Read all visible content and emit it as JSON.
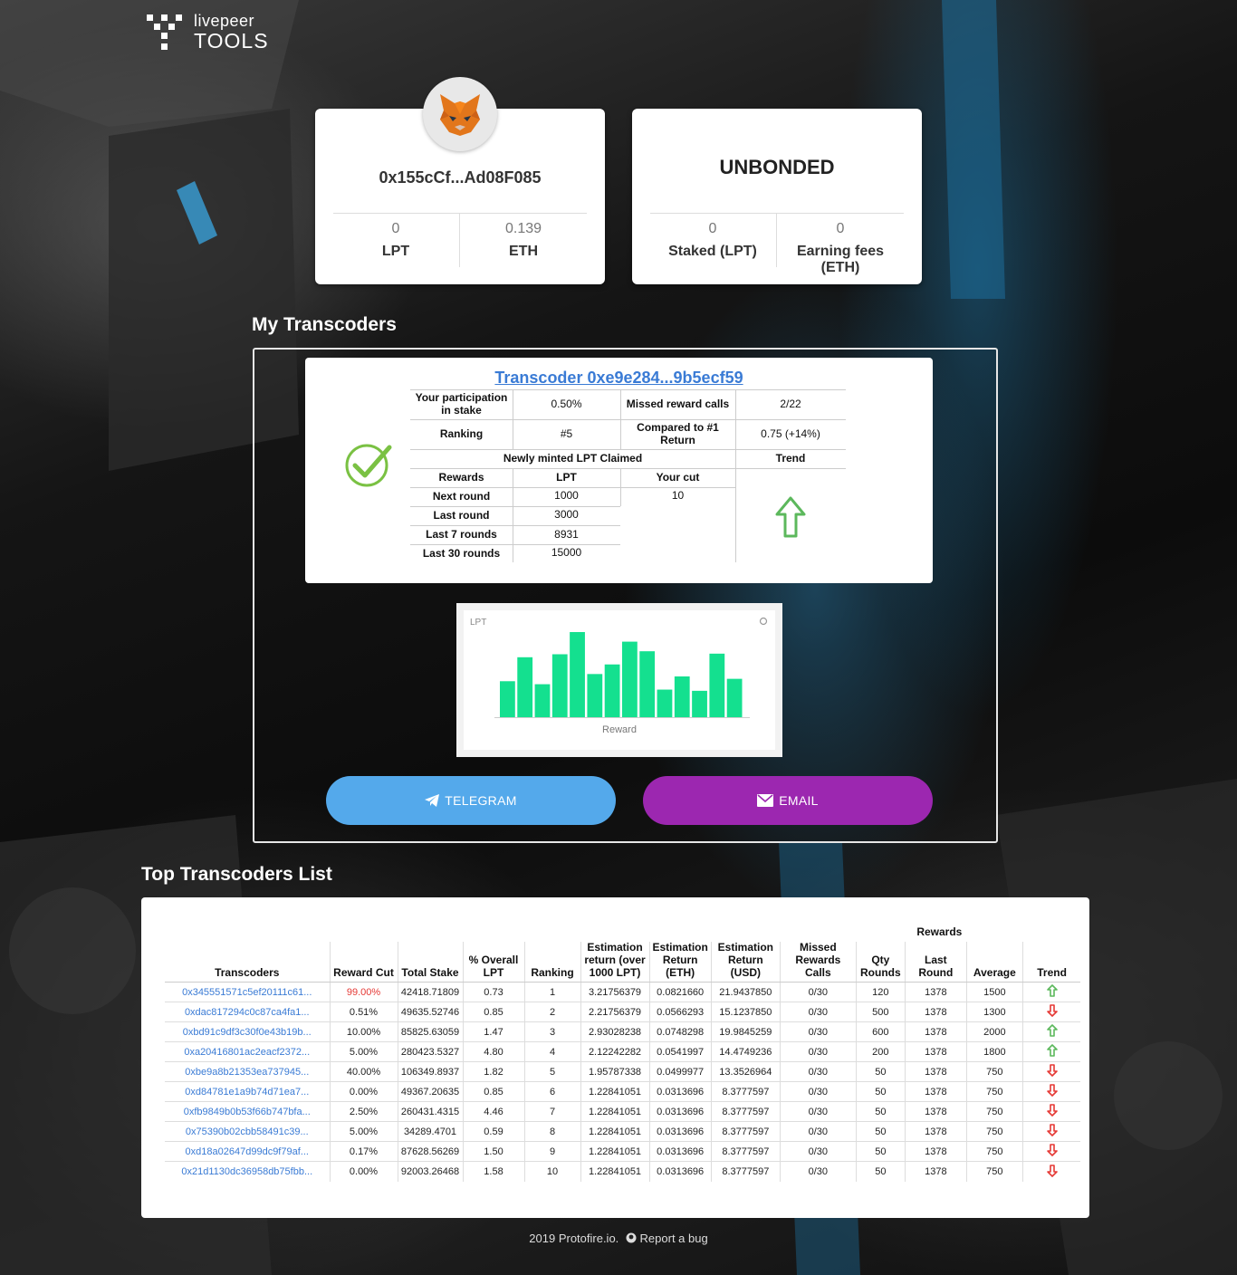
{
  "logo": {
    "line1": "livepeer",
    "line2": "TOOLS"
  },
  "account": {
    "address": "0x155cCf...Ad08F085",
    "stats": [
      {
        "value": "0",
        "label": "LPT"
      },
      {
        "value": "0.139",
        "label": "ETH"
      }
    ]
  },
  "bond": {
    "status": "UNBONDED",
    "stats": [
      {
        "value": "0",
        "label": "Staked (LPT)"
      },
      {
        "value": "0",
        "label": "Earning fees (ETH)"
      }
    ]
  },
  "my_transcoders": {
    "title": "My Transcoders",
    "link": "Transcoder 0xe9e284...9b5ecf59",
    "participation_label": "Your participation in stake",
    "participation_value": "0.50%",
    "missed_label": "Missed reward calls",
    "missed_value": "2/22",
    "ranking_label": "Ranking",
    "ranking_value": "#5",
    "compared_label": "Compared to #1 Return",
    "compared_value": "0.75 (+14%)",
    "minted_label": "Newly minted LPT Claimed",
    "trend_label": "Trend",
    "rewards_label": "Rewards",
    "lpt_label": "LPT",
    "cut_label": "Your cut",
    "rows": [
      {
        "label": "Next round",
        "lpt": "1000",
        "cut": "10"
      },
      {
        "label": "Last round",
        "lpt": "3000"
      },
      {
        "label": "Last 7 rounds",
        "lpt": "8931"
      },
      {
        "label": "Last 30 rounds",
        "lpt": "15000"
      }
    ],
    "colors": {
      "check": "#7ac143",
      "trend_up": "#5cb85c"
    }
  },
  "chart_data": {
    "type": "bar",
    "ylabel": "LPT",
    "xlabel": "Reward",
    "values": [
      6,
      10,
      5.5,
      10.5,
      14.2,
      7.2,
      8.8,
      12.6,
      11,
      4.6,
      6.8,
      4.4,
      10.6,
      6.4
    ],
    "color": "#14e08f"
  },
  "buttons": {
    "telegram": "TELEGRAM",
    "email": "EMAIL"
  },
  "top_list": {
    "title": "Top Transcoders List",
    "group_header": "Rewards",
    "headers": [
      "Transcoders",
      "Reward Cut",
      "Total Stake",
      "% Overall LPT",
      "Ranking",
      "Estimation return (over 1000 LPT)",
      "Estimation Return (ETH)",
      "Estimation Return (USD)",
      "Missed Rewards Calls",
      "Qty Rounds",
      "Last Round",
      "Average",
      "Trend"
    ],
    "rows": [
      {
        "addr": "0x345551571c5ef20111c61...",
        "cut": "99.00%",
        "stake": "42418.71809",
        "overall": "0.73",
        "rank": "1",
        "est": "3.21756379",
        "eth": "0.0821660",
        "usd": "21.9437850",
        "missed": "0/30",
        "qty": "120",
        "last": "1378",
        "avg": "1500",
        "trend": "up"
      },
      {
        "addr": "0xdac817294c0c87ca4fa1...",
        "cut": "0.51%",
        "stake": "49635.52746",
        "overall": "0.85",
        "rank": "2",
        "est": "2.21756379",
        "eth": "0.0566293",
        "usd": "15.1237850",
        "missed": "0/30",
        "qty": "500",
        "last": "1378",
        "avg": "1300",
        "trend": "down"
      },
      {
        "addr": "0xbd91c9df3c30f0e43b19b...",
        "cut": "10.00%",
        "stake": "85825.63059",
        "overall": "1.47",
        "rank": "3",
        "est": "2.93028238",
        "eth": "0.0748298",
        "usd": "19.9845259",
        "missed": "0/30",
        "qty": "600",
        "last": "1378",
        "avg": "2000",
        "trend": "up"
      },
      {
        "addr": "0xa20416801ac2eacf2372...",
        "cut": "5.00%",
        "stake": "280423.5327",
        "overall": "4.80",
        "rank": "4",
        "est": "2.12242282",
        "eth": "0.0541997",
        "usd": "14.4749236",
        "missed": "0/30",
        "qty": "200",
        "last": "1378",
        "avg": "1800",
        "trend": "up"
      },
      {
        "addr": "0xbe9a8b21353ea737945...",
        "cut": "40.00%",
        "stake": "106349.8937",
        "overall": "1.82",
        "rank": "5",
        "est": "1.95787338",
        "eth": "0.0499977",
        "usd": "13.3526964",
        "missed": "0/30",
        "qty": "50",
        "last": "1378",
        "avg": "750",
        "trend": "down"
      },
      {
        "addr": "0xd84781e1a9b74d71ea7...",
        "cut": "0.00%",
        "stake": "49367.20635",
        "overall": "0.85",
        "rank": "6",
        "est": "1.22841051",
        "eth": "0.0313696",
        "usd": "8.3777597",
        "missed": "0/30",
        "qty": "50",
        "last": "1378",
        "avg": "750",
        "trend": "down"
      },
      {
        "addr": "0xfb9849b0b53f66b747bfa...",
        "cut": "2.50%",
        "stake": "260431.4315",
        "overall": "4.46",
        "rank": "7",
        "est": "1.22841051",
        "eth": "0.0313696",
        "usd": "8.3777597",
        "missed": "0/30",
        "qty": "50",
        "last": "1378",
        "avg": "750",
        "trend": "down"
      },
      {
        "addr": "0x75390b02cbb58491c39...",
        "cut": "5.00%",
        "stake": "34289.4701",
        "overall": "0.59",
        "rank": "8",
        "est": "1.22841051",
        "eth": "0.0313696",
        "usd": "8.3777597",
        "missed": "0/30",
        "qty": "50",
        "last": "1378",
        "avg": "750",
        "trend": "down"
      },
      {
        "addr": "0xd18a02647d99dc9f79af...",
        "cut": "0.17%",
        "stake": "87628.56269",
        "overall": "1.50",
        "rank": "9",
        "est": "1.22841051",
        "eth": "0.0313696",
        "usd": "8.3777597",
        "missed": "0/30",
        "qty": "50",
        "last": "1378",
        "avg": "750",
        "trend": "down"
      },
      {
        "addr": "0x21d1130dc36958db75fbb...",
        "cut": "0.00%",
        "stake": "92003.26468",
        "overall": "1.58",
        "rank": "10",
        "est": "1.22841051",
        "eth": "0.0313696",
        "usd": "8.3777597",
        "missed": "0/30",
        "qty": "50",
        "last": "1378",
        "avg": "750",
        "trend": "down"
      }
    ],
    "colors": {
      "up": "#5cb85c",
      "down": "#e53935",
      "highlight": "#e53935",
      "link": "#3a7bd5"
    }
  },
  "footer": {
    "text": "2019 Protofire.io.",
    "report": "Report a bug"
  }
}
